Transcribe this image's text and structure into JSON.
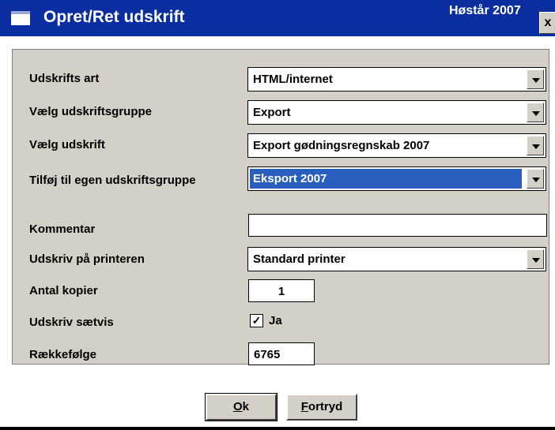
{
  "window": {
    "title": "Opret/Ret udskrift",
    "season": "Høstår 2007",
    "close_label": "x"
  },
  "form": {
    "udskrifts_art": {
      "label": "Udskrifts art",
      "value": "HTML/internet"
    },
    "udskriftsgruppe": {
      "label": "Vælg udskriftsgruppe",
      "value": "Export"
    },
    "udskrift": {
      "label": "Vælg udskrift",
      "value": "Export gødningsregnskab 2007"
    },
    "egen_gruppe": {
      "label": "Tilføj til egen udskriftsgruppe",
      "value": "Eksport 2007"
    },
    "kommentar": {
      "label": "Kommentar",
      "value": ""
    },
    "printer": {
      "label": "Udskriv på printeren",
      "value": "Standard printer"
    },
    "kopier": {
      "label": "Antal kopier",
      "value": "1"
    },
    "saetvis": {
      "label": "Udskriv sætvis",
      "checked_mark": "✓",
      "option_label": "Ja"
    },
    "raekkefoelge": {
      "label": "Rækkefølge",
      "value": "6765"
    }
  },
  "buttons": {
    "ok": {
      "accel": "O",
      "rest": "k"
    },
    "fortryd": {
      "accel": "F",
      "rest": "ortryd"
    }
  }
}
